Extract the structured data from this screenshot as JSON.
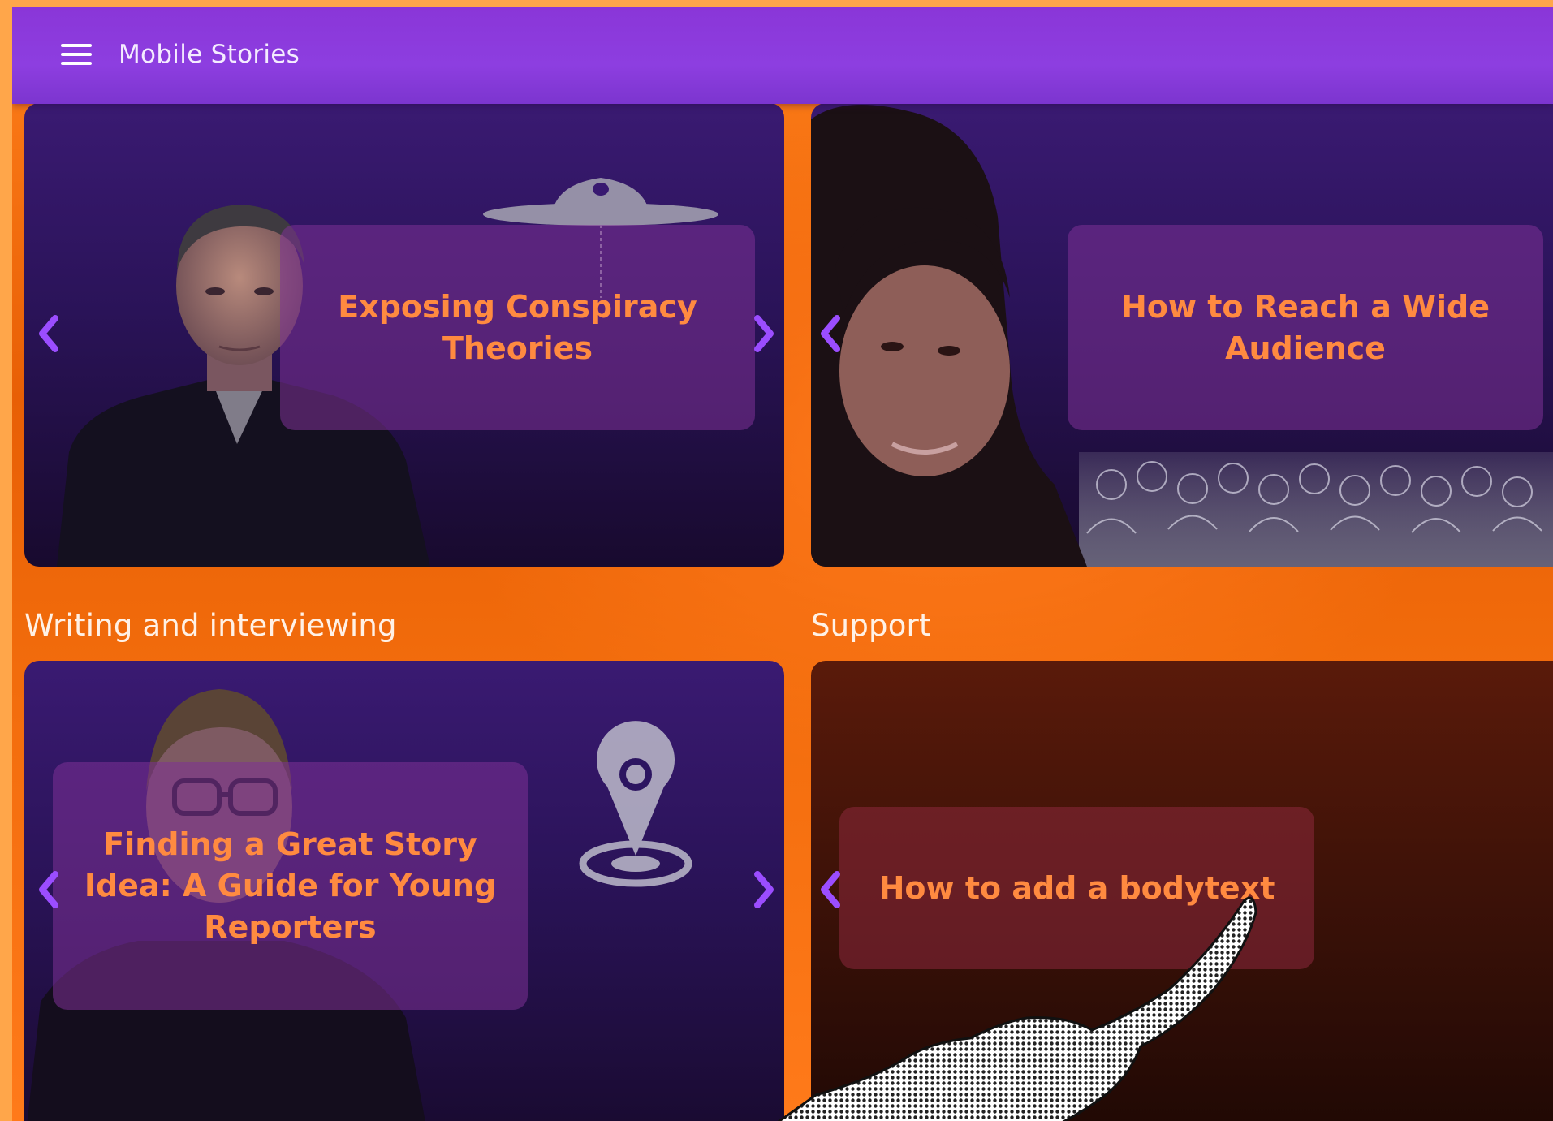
{
  "app": {
    "title": "Mobile Stories"
  },
  "rows": [
    {
      "cards": [
        {
          "title": "Exposing Conspiracy Theories"
        },
        {
          "title": "How to Reach a Wide Audience"
        }
      ]
    },
    {
      "sections": [
        "Writing and interviewing",
        "Support"
      ],
      "cards": [
        {
          "title": "Finding a Great Story Idea: A Guide for Young Reporters"
        },
        {
          "title": "How to add a bodytext"
        }
      ]
    }
  ],
  "icons": [
    "menu-icon",
    "ufo-icon",
    "location-pin-icon",
    "chevron-left-icon",
    "chevron-right-icon",
    "pointing-hand-icon"
  ],
  "colors": {
    "appbar": "#8a36d8",
    "background": "#f06a0c",
    "card_title": "#ff8a40",
    "arrow": "#9b4dff",
    "frame": "#ffa64a"
  }
}
